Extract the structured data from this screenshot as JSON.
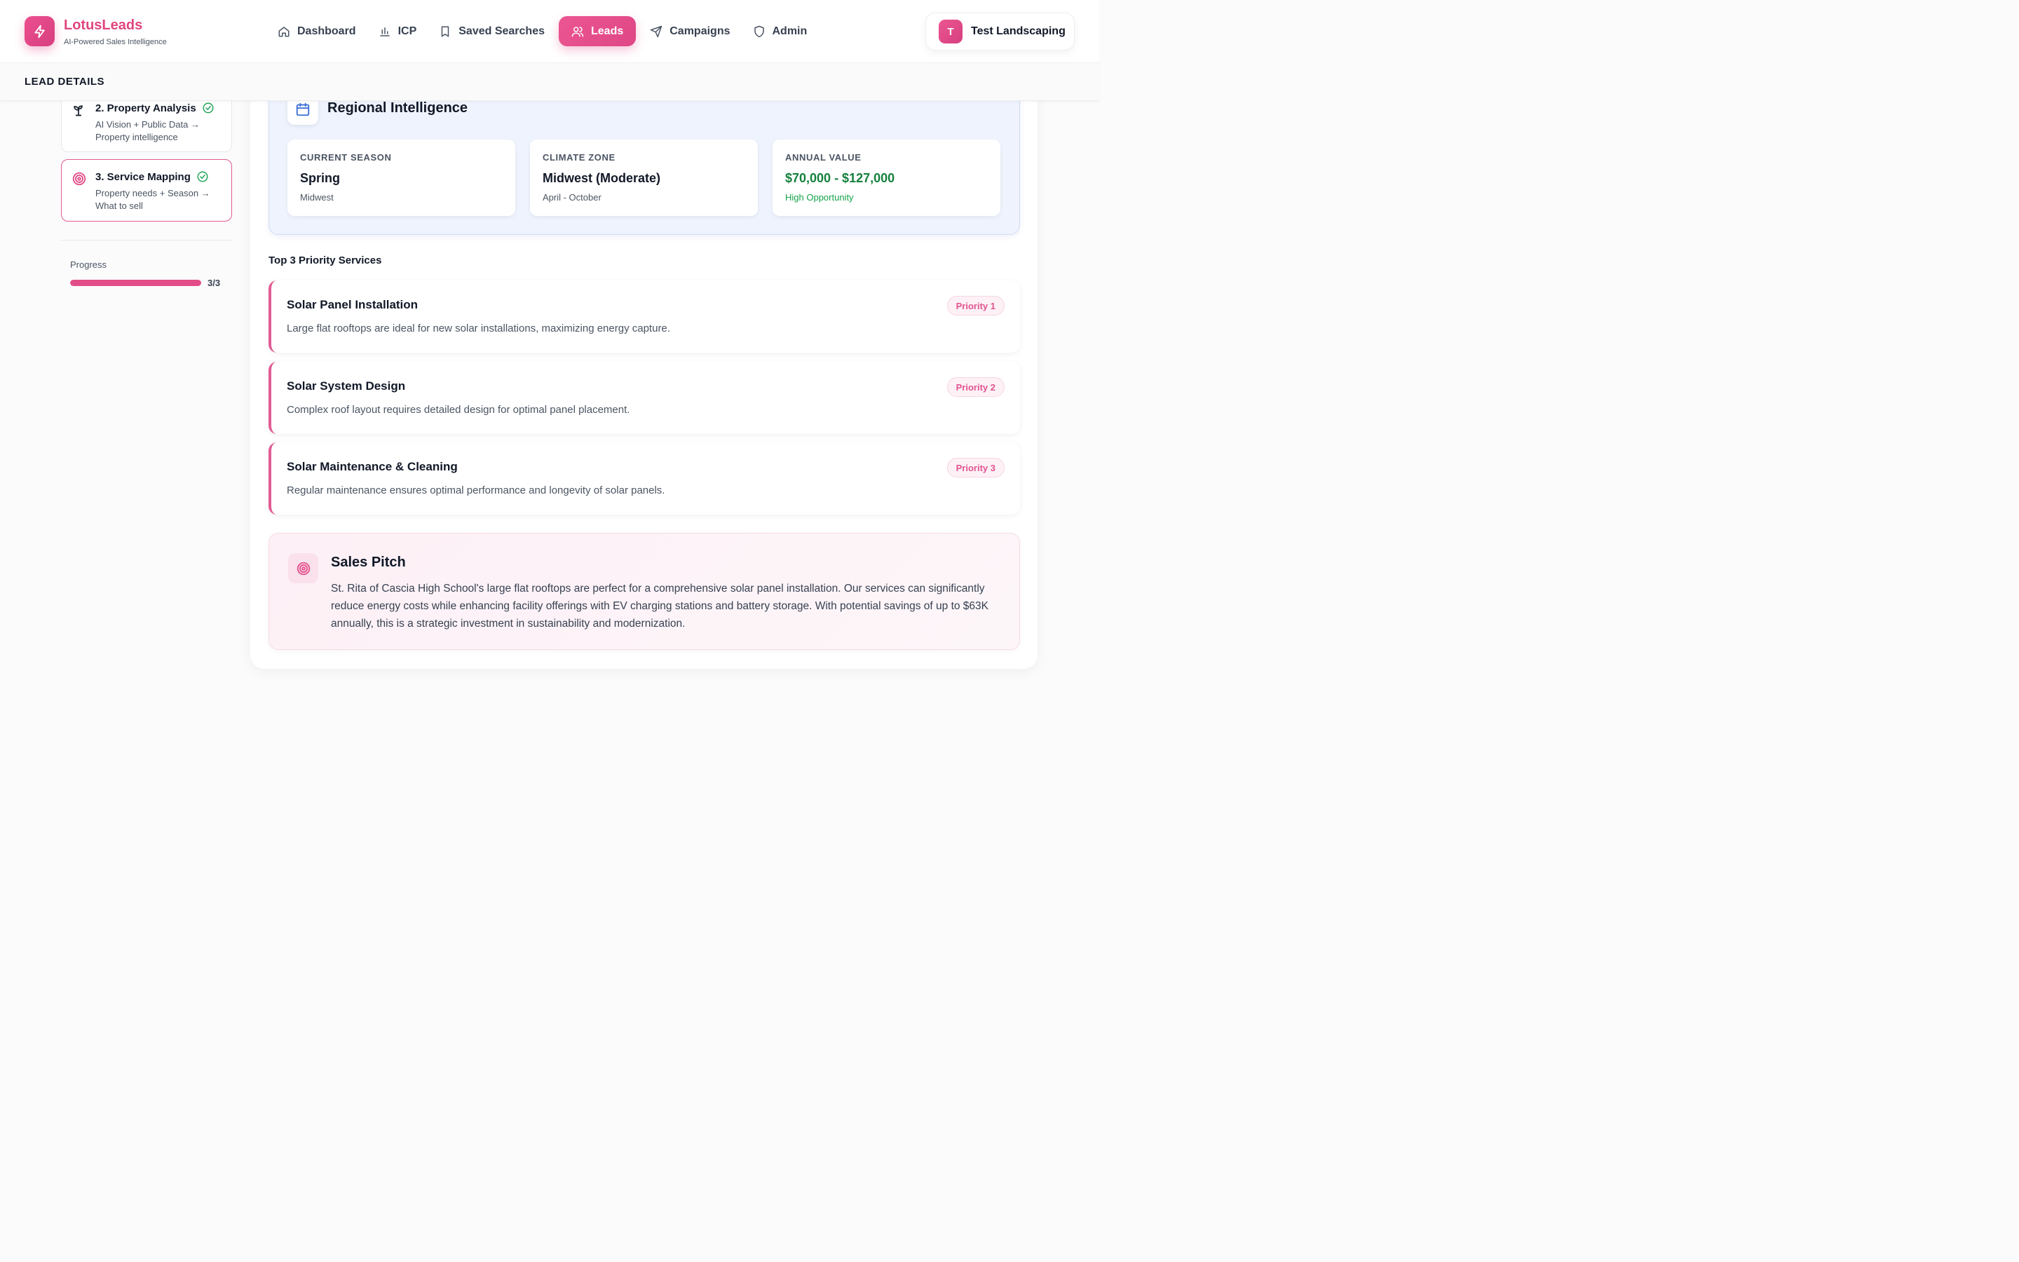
{
  "brand": {
    "name": "LotusLeads",
    "tagline": "AI-Powered Sales Intelligence"
  },
  "nav": [
    {
      "label": "Dashboard",
      "icon": "home-icon"
    },
    {
      "label": "ICP",
      "icon": "bar-chart-icon"
    },
    {
      "label": "Saved Searches",
      "icon": "bookmark-icon"
    },
    {
      "label": "Leads",
      "icon": "users-icon",
      "active": true
    },
    {
      "label": "Campaigns",
      "icon": "send-icon"
    },
    {
      "label": "Admin",
      "icon": "shield-icon"
    }
  ],
  "user": {
    "initial": "T",
    "name": "Test Landscaping"
  },
  "subheader": {
    "title": "LEAD DETAILS"
  },
  "steps": [
    {
      "title": "2. Property Analysis",
      "desc": "AI Vision + Public Data → Property intelligence",
      "icon": "sprout-icon",
      "complete": true
    },
    {
      "title": "3. Service Mapping",
      "desc": "Property needs + Season → What to sell",
      "icon": "target-icon",
      "complete": true,
      "active": true
    }
  ],
  "progress": {
    "label": "Progress",
    "count": "3/3",
    "fraction": 1.0
  },
  "regional": {
    "title": "Regional Intelligence",
    "cards": [
      {
        "label": "CURRENT SEASON",
        "value": "Spring",
        "sub": "Midwest"
      },
      {
        "label": "CLIMATE ZONE",
        "value": "Midwest (Moderate)",
        "sub": "April - October"
      },
      {
        "label": "ANNUAL VALUE",
        "value": "$70,000 - $127,000",
        "sub": "High Opportunity"
      }
    ]
  },
  "services": {
    "heading": "Top 3 Priority Services",
    "items": [
      {
        "title": "Solar Panel Installation",
        "desc": "Large flat rooftops are ideal for new solar installations, maximizing energy capture.",
        "priority": "Priority 1"
      },
      {
        "title": "Solar System Design",
        "desc": "Complex roof layout requires detailed design for optimal panel placement.",
        "priority": "Priority 2"
      },
      {
        "title": "Solar Maintenance & Cleaning",
        "desc": "Regular maintenance ensures optimal performance and longevity of solar panels.",
        "priority": "Priority 3"
      }
    ]
  },
  "pitch": {
    "title": "Sales Pitch",
    "text": "St. Rita of Cascia High School's large flat rooftops are perfect for a comprehensive solar panel installation. Our services can significantly reduce energy costs while enhancing facility offerings with EV charging stations and battery storage. With potential savings of up to $63K annually, this is a strategic investment in sustainability and modernization."
  },
  "colors": {
    "accent": "#e24d89",
    "success": "#16a34a",
    "regional_bg": "#eef3fd"
  }
}
